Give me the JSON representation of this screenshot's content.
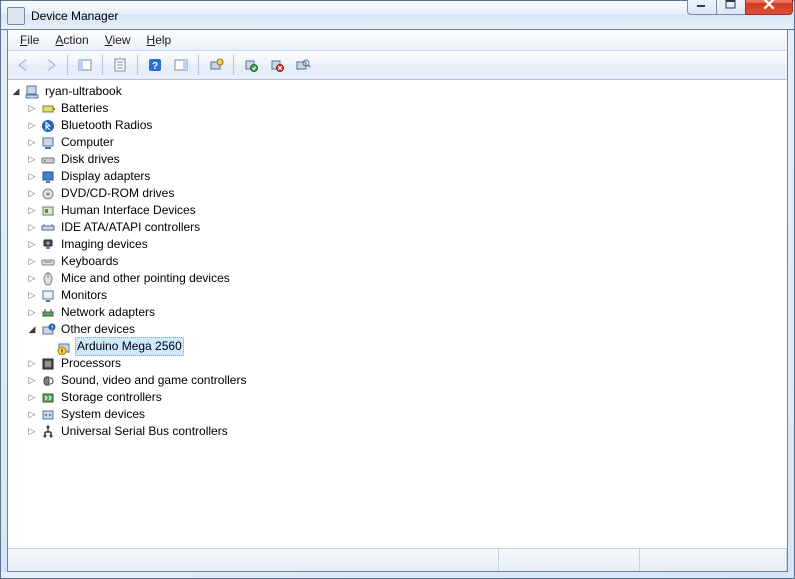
{
  "window": {
    "title": "Device Manager"
  },
  "menu": {
    "file": "File",
    "action": "Action",
    "view": "View",
    "help": "Help"
  },
  "tree": {
    "root": "ryan-ultrabook",
    "categories": [
      "Batteries",
      "Bluetooth Radios",
      "Computer",
      "Disk drives",
      "Display adapters",
      "DVD/CD-ROM drives",
      "Human Interface Devices",
      "IDE ATA/ATAPI controllers",
      "Imaging devices",
      "Keyboards",
      "Mice and other pointing devices",
      "Monitors",
      "Network adapters",
      "Other devices",
      "Processors",
      "Sound, video and game controllers",
      "Storage controllers",
      "System devices",
      "Universal Serial Bus controllers"
    ],
    "expanded_category_index": 13,
    "selected_device": "Arduino Mega 2560"
  }
}
